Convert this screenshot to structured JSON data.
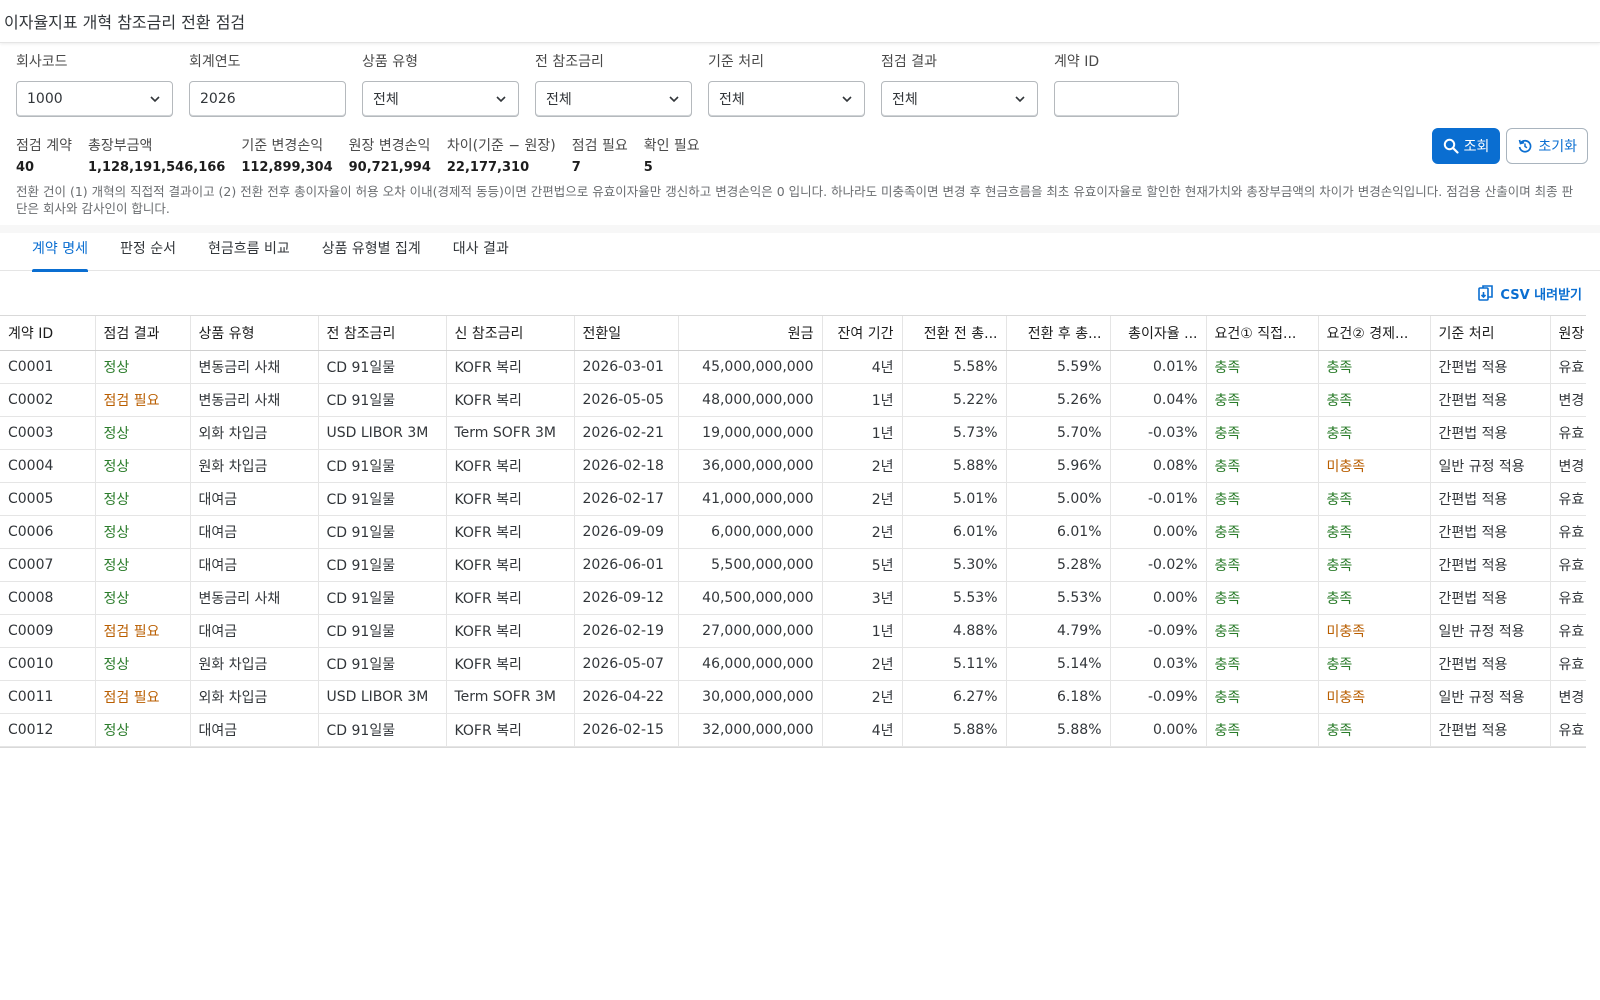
{
  "app": {
    "title": "이자율지표 개혁 참조금리 전환 점검"
  },
  "filters": [
    {
      "label": "회사코드",
      "value": "1000",
      "type": "select"
    },
    {
      "label": "회계연도",
      "value": "2026",
      "type": "input"
    },
    {
      "label": "상품 유형",
      "value": "전체",
      "type": "select"
    },
    {
      "label": "전 참조금리",
      "value": "전체",
      "type": "select"
    },
    {
      "label": "기준 처리",
      "value": "전체",
      "type": "select"
    },
    {
      "label": "점검 결과",
      "value": "전체",
      "type": "select"
    },
    {
      "label": "계약 ID",
      "value": "",
      "type": "input"
    }
  ],
  "actions": {
    "search_label": "조회",
    "reset_label": "초기화"
  },
  "summary": [
    {
      "label": "점검 계약",
      "value": "40"
    },
    {
      "label": "총장부금액",
      "value": "1,128,191,546,166"
    },
    {
      "label": "기준 변경손익",
      "value": "112,899,304"
    },
    {
      "label": "원장 변경손익",
      "value": "90,721,994"
    },
    {
      "label": "차이(기준 − 원장)",
      "value": "22,177,310"
    },
    {
      "label": "점검 필요",
      "value": "7"
    },
    {
      "label": "확인 필요",
      "value": "5"
    }
  ],
  "notice": "전환 건이 (1) 개혁의 직접적 결과이고 (2) 전환 전후 총이자율이 허용 오차 이내(경제적 동등)이면 간편법으로 유효이자율만 갱신하고 변경손익은 0 입니다. 하나라도 미충족이면 변경 후 현금흐름을 최초 유효이자율로 할인한 현재가치와 총장부금액의 차이가 변경손익입니다. 점검용 산출이며 최종 판단은 회사와 감사인이 합니다.",
  "tabs": [
    "계약 명세",
    "판정 순서",
    "현금흐름 비교",
    "상품 유형별 집계",
    "대사 결과"
  ],
  "active_tab": 0,
  "csv_label": "CSV 내려받기",
  "table": {
    "columns": [
      "계약 ID",
      "점검 결과",
      "상품 유형",
      "전 참조금리",
      "신 참조금리",
      "전환일",
      "원금",
      "잔여 기간",
      "전환 전 총...",
      "전환 후 총...",
      "총이자율 ...",
      "요건① 직접...",
      "요건② 경제...",
      "기준 처리",
      "원장"
    ],
    "rows": [
      [
        "C0001",
        "정상",
        "변동금리 사채",
        "CD 91일물",
        "KOFR 복리",
        "2026-03-01",
        "45,000,000,000",
        "4년",
        "5.58%",
        "5.59%",
        "0.01%",
        "충족",
        "충족",
        "간편법 적용",
        "유효"
      ],
      [
        "C0002",
        "점검 필요",
        "변동금리 사채",
        "CD 91일물",
        "KOFR 복리",
        "2026-05-05",
        "48,000,000,000",
        "1년",
        "5.22%",
        "5.26%",
        "0.04%",
        "충족",
        "충족",
        "간편법 적용",
        "변경"
      ],
      [
        "C0003",
        "정상",
        "외화 차입금",
        "USD LIBOR 3M",
        "Term SOFR 3M",
        "2026-02-21",
        "19,000,000,000",
        "1년",
        "5.73%",
        "5.70%",
        "-0.03%",
        "충족",
        "충족",
        "간편법 적용",
        "유효"
      ],
      [
        "C0004",
        "정상",
        "원화 차입금",
        "CD 91일물",
        "KOFR 복리",
        "2026-02-18",
        "36,000,000,000",
        "2년",
        "5.88%",
        "5.96%",
        "0.08%",
        "충족",
        "미충족",
        "일반 규정 적용",
        "변경"
      ],
      [
        "C0005",
        "정상",
        "대여금",
        "CD 91일물",
        "KOFR 복리",
        "2026-02-17",
        "41,000,000,000",
        "2년",
        "5.01%",
        "5.00%",
        "-0.01%",
        "충족",
        "충족",
        "간편법 적용",
        "유효"
      ],
      [
        "C0006",
        "정상",
        "대여금",
        "CD 91일물",
        "KOFR 복리",
        "2026-09-09",
        "6,000,000,000",
        "2년",
        "6.01%",
        "6.01%",
        "0.00%",
        "충족",
        "충족",
        "간편법 적용",
        "유효"
      ],
      [
        "C0007",
        "정상",
        "대여금",
        "CD 91일물",
        "KOFR 복리",
        "2026-06-01",
        "5,500,000,000",
        "5년",
        "5.30%",
        "5.28%",
        "-0.02%",
        "충족",
        "충족",
        "간편법 적용",
        "유효"
      ],
      [
        "C0008",
        "정상",
        "변동금리 사채",
        "CD 91일물",
        "KOFR 복리",
        "2026-09-12",
        "40,500,000,000",
        "3년",
        "5.53%",
        "5.53%",
        "0.00%",
        "충족",
        "충족",
        "간편법 적용",
        "유효"
      ],
      [
        "C0009",
        "점검 필요",
        "대여금",
        "CD 91일물",
        "KOFR 복리",
        "2026-02-19",
        "27,000,000,000",
        "1년",
        "4.88%",
        "4.79%",
        "-0.09%",
        "충족",
        "미충족",
        "일반 규정 적용",
        "유효"
      ],
      [
        "C0010",
        "정상",
        "원화 차입금",
        "CD 91일물",
        "KOFR 복리",
        "2026-05-07",
        "46,000,000,000",
        "2년",
        "5.11%",
        "5.14%",
        "0.03%",
        "충족",
        "충족",
        "간편법 적용",
        "유효"
      ],
      [
        "C0011",
        "점검 필요",
        "외화 차입금",
        "USD LIBOR 3M",
        "Term SOFR 3M",
        "2026-04-22",
        "30,000,000,000",
        "2년",
        "6.27%",
        "6.18%",
        "-0.09%",
        "충족",
        "미충족",
        "일반 규정 적용",
        "변경"
      ],
      [
        "C0012",
        "정상",
        "대여금",
        "CD 91일물",
        "KOFR 복리",
        "2026-02-15",
        "32,000,000,000",
        "4년",
        "5.88%",
        "5.88%",
        "0.00%",
        "충족",
        "충족",
        "간편법 적용",
        "유효"
      ]
    ]
  },
  "colors": {
    "accent": "#0a6ed1",
    "ok": "#2b7c2b",
    "warn": "#b95e00"
  }
}
